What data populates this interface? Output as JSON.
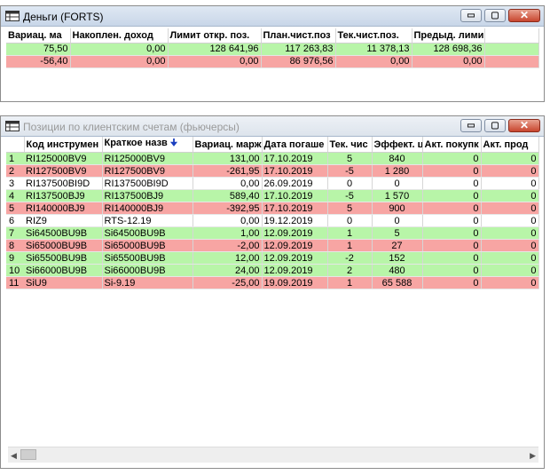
{
  "money_window": {
    "title": "Деньги (FORTS)",
    "columns": [
      "Вариац. ма",
      "Накоплен. доход",
      "Лимит откр. поз.",
      "План.чист.поз",
      "Тек.чист.поз.",
      "Предыд. лими",
      ""
    ],
    "rows": [
      {
        "color": "green",
        "cells": [
          "75,50",
          "0,00",
          "128 641,96",
          "117 263,83",
          "11 378,13",
          "128 698,36",
          ""
        ]
      },
      {
        "color": "red",
        "cells": [
          "-56,40",
          "0,00",
          "0,00",
          "86 976,56",
          "0,00",
          "0,00",
          ""
        ]
      }
    ]
  },
  "positions_window": {
    "title": "Позиции по клиентским счетам (фьючерсы)",
    "columns": [
      "",
      "Код инструмен",
      "Краткое назв",
      "Вариац. марж",
      "Дата погаше",
      "Тек. чис",
      "Эффект. ц",
      "Акт. покупк",
      "Акт. прод"
    ],
    "rows": [
      {
        "color": "green",
        "cells": [
          "1",
          "RI125000BV9",
          "RI125000BV9",
          "131,00",
          "17.10.2019",
          "5",
          "840",
          "0",
          "0"
        ]
      },
      {
        "color": "red",
        "cells": [
          "2",
          "RI127500BV9",
          "RI127500BV9",
          "-261,95",
          "17.10.2019",
          "-5",
          "1 280",
          "0",
          "0"
        ]
      },
      {
        "color": "white",
        "cells": [
          "3",
          "RI137500BI9D",
          "RI137500BI9D",
          "0,00",
          "26.09.2019",
          "0",
          "0",
          "0",
          "0"
        ]
      },
      {
        "color": "green",
        "cells": [
          "4",
          "RI137500BJ9",
          "RI137500BJ9",
          "589,40",
          "17.10.2019",
          "-5",
          "1 570",
          "0",
          "0"
        ]
      },
      {
        "color": "red",
        "cells": [
          "5",
          "RI140000BJ9",
          "RI140000BJ9",
          "-392,95",
          "17.10.2019",
          "5",
          "900",
          "0",
          "0"
        ]
      },
      {
        "color": "white",
        "cells": [
          "6",
          "RIZ9",
          "RTS-12.19",
          "0,00",
          "19.12.2019",
          "0",
          "0",
          "0",
          "0"
        ]
      },
      {
        "color": "green",
        "cells": [
          "7",
          "Si64500BU9B",
          "Si64500BU9B",
          "1,00",
          "12.09.2019",
          "1",
          "5",
          "0",
          "0"
        ]
      },
      {
        "color": "red",
        "cells": [
          "8",
          "Si65000BU9B",
          "Si65000BU9B",
          "-2,00",
          "12.09.2019",
          "1",
          "27",
          "0",
          "0"
        ]
      },
      {
        "color": "green",
        "cells": [
          "9",
          "Si65500BU9B",
          "Si65500BU9B",
          "12,00",
          "12.09.2019",
          "-2",
          "152",
          "0",
          "0"
        ]
      },
      {
        "color": "green",
        "cells": [
          "10",
          "Si66000BU9B",
          "Si66000BU9B",
          "24,00",
          "12.09.2019",
          "2",
          "480",
          "0",
          "0"
        ]
      },
      {
        "color": "red",
        "cells": [
          "11",
          "SiU9",
          "Si-9.19",
          "-25,00",
          "19.09.2019",
          "1",
          "65 588",
          "0",
          "0"
        ]
      }
    ]
  },
  "window_buttons": {
    "minimize": "▭",
    "maximize": "▢",
    "close": "✕"
  },
  "scroll_arrows": {
    "left": "◀",
    "right": "▶"
  },
  "sort_indicator": "🠋",
  "colors": {
    "green_row": "#b8f5a8",
    "red_row": "#f7a5a3"
  }
}
